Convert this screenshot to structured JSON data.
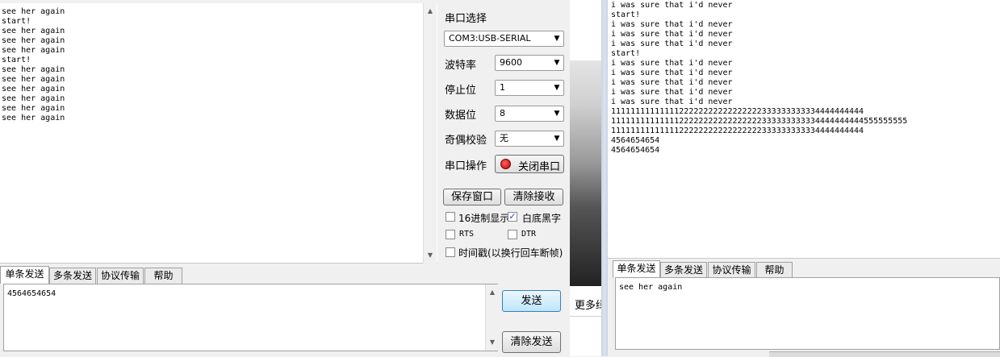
{
  "left_window": {
    "receive_lines": [
      "see her again",
      "start!",
      "see her again",
      "see her again",
      "see her again",
      "start!",
      "see her again",
      "see her again",
      "see her again",
      "see her again",
      "see her again",
      "see her again"
    ],
    "port_select_label": "串口选择",
    "port_value": "COM3:USB-SERIAL",
    "baud_label": "波特率",
    "baud_value": "9600",
    "stop_label": "停止位",
    "stop_value": "1",
    "data_label": "数据位",
    "data_value": "8",
    "parity_label": "奇偶校验",
    "parity_value": "无",
    "op_label": "串口操作",
    "close_port_label": "关闭串口",
    "save_window_label": "保存窗口",
    "clear_receive_label": "清除接收",
    "hex_display_label": "16进制显示",
    "white_bg_label": "白底黑字",
    "rts_label": "RTS",
    "dtr_label": "DTR",
    "timestamp_label": "时间戳(以换行回车断帧)",
    "tabs": [
      "单条发送",
      "多条发送",
      "协议传输",
      "帮助"
    ],
    "send_text": "4564654654",
    "send_label": "发送",
    "clear_send_label": "清除发送"
  },
  "middle": {
    "more_text": "更多绿"
  },
  "right_window": {
    "receive_lines": [
      "i was sure that i'd never",
      "start!",
      "i was sure that i'd never",
      "i was sure that i'd never",
      "i was sure that i'd never",
      "start!",
      "i was sure that i'd never",
      "i was sure that i'd never",
      "i was sure that i'd never",
      "i was sure that i'd never",
      "i was sure that i'd never",
      "1111111111111122222222222222222333333333334444444444",
      "1111111111111122222222222222222333333333334444444444555555555",
      "1111111111111122222222222222222333333333334444444444",
      "4564654654",
      "4564654654"
    ],
    "tabs": [
      "单条发送",
      "多条发送",
      "协议传输",
      "帮助"
    ],
    "send_text": "see her again"
  }
}
